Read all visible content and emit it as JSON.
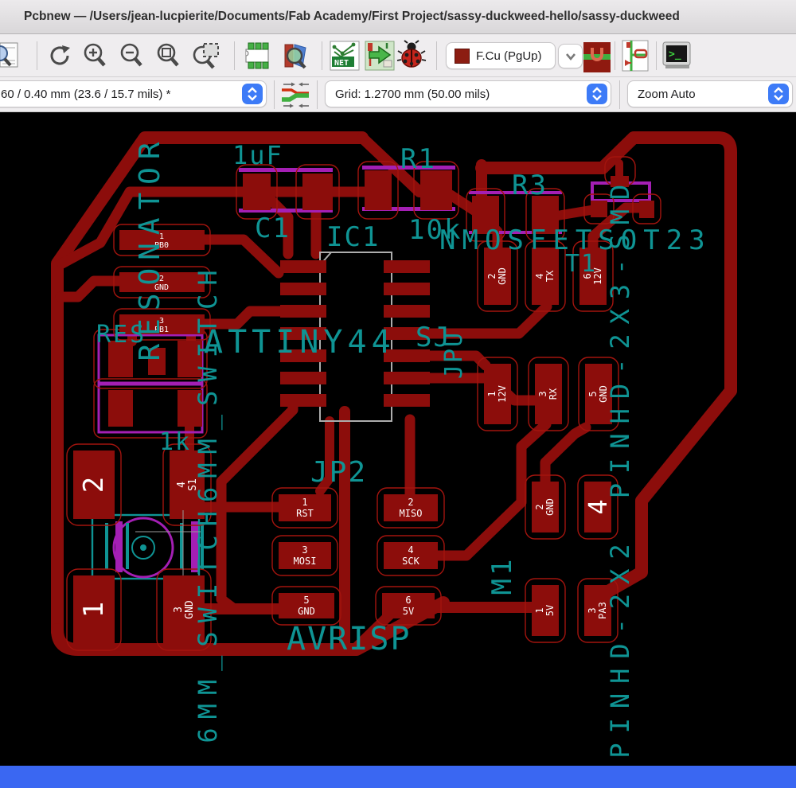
{
  "window": {
    "title": "Pcbnew — /Users/jean-lucpierite/Documents/Fab Academy/First Project/sassy-duckweed-hello/sassy-duckweed"
  },
  "toolbar": {
    "icons": [
      "page-zoom-preview",
      "redraw-view",
      "zoom-in",
      "zoom-out",
      "zoom-fit",
      "zoom-to-selection",
      "footprint-editor",
      "footprint-viewer",
      "load-netlist",
      "update-pcb-from-schematic",
      "design-rules-check",
      "layer-pair-toggle",
      "footprint-mode",
      "python-console"
    ],
    "net_badge": "NET",
    "layer_selector": {
      "value": "F.Cu (PgUp)",
      "swatch_color": "#8c1d12"
    }
  },
  "toolbar2": {
    "track_width": "60 / 0.40 mm (23.6 / 15.7 mils) *",
    "grid": "Grid: 1.2700 mm (50.00 mils)",
    "zoom": "Zoom Auto"
  },
  "pcb": {
    "colors": {
      "copper": "#8c0d0b",
      "pad_outline": "#a3140e",
      "silkscreen": "#0f9494",
      "footprint_body": "#a41fb4",
      "ic_outline": "#adadad",
      "canvas": "#000000",
      "bottom_strip": "#3a67f2",
      "macos_accent": "#3d7bf7"
    },
    "silk": {
      "resonator_v": "RESONATOR",
      "res": "RES",
      "c1_val": "1uF",
      "c1": "C1",
      "r1": "R1",
      "r1_val": "10k",
      "r3": "R3",
      "ic1": "IC1",
      "ic1_val": "ATTINY44",
      "nmosfet": "NMOSFETSOT23",
      "sj": "SJ",
      "jpu": "JPU",
      "t1": "T1",
      "pinhd23": "PINHD-2X3-SMD",
      "pinhd22": "PINHD-2X2",
      "jp2": "JP2",
      "jp2_val": "AVRISP",
      "m1": "M1",
      "r_1k": "1k",
      "switch_v": "6MM_SWITCH6MM_SWITCH"
    },
    "jp1_pads": [
      {
        "num": "1",
        "name": "PB0"
      },
      {
        "num": "2",
        "name": "GND"
      },
      {
        "num": "3",
        "name": "PB1"
      }
    ],
    "ftdi_pads": [
      {
        "num": "2",
        "name": "GND"
      },
      {
        "num": "4",
        "name": "TX"
      },
      {
        "num": "6",
        "name": "12V"
      },
      {
        "num": "1",
        "name": "12V"
      },
      {
        "num": "3",
        "name": "RX"
      },
      {
        "num": "5",
        "name": "GND"
      }
    ],
    "m1_pads": [
      {
        "num": "2",
        "name": "GND"
      },
      {
        "num": "4",
        "name": ""
      },
      {
        "num": "1",
        "name": "5V"
      },
      {
        "num": "3",
        "name": "PA3"
      }
    ],
    "jp2_pads": [
      {
        "num": "1",
        "name": "RST"
      },
      {
        "num": "2",
        "name": "MISO"
      },
      {
        "num": "3",
        "name": "MOSI"
      },
      {
        "num": "4",
        "name": "SCK"
      },
      {
        "num": "5",
        "name": "GND"
      },
      {
        "num": "6",
        "name": "5V"
      }
    ],
    "s1_pads": [
      {
        "num": "2",
        "name": ""
      },
      {
        "num": "4",
        "name": "S1"
      },
      {
        "num": "1",
        "name": ""
      },
      {
        "num": "3",
        "name": "GND"
      }
    ]
  }
}
